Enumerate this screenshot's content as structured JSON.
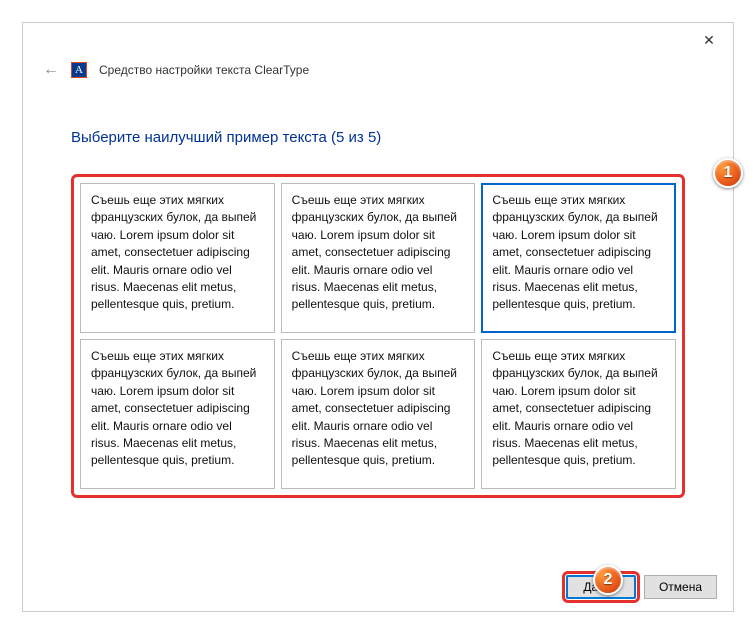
{
  "window": {
    "title": "Средство настройки текста ClearType",
    "app_icon_letter": "A",
    "close_label": "✕"
  },
  "heading": "Выберите наилучший пример текста (5 из 5)",
  "sample_text": "Съешь еще этих мягких французских булок, да выпей чаю. Lorem ipsum dolor sit amet, consectetuer adipiscing elit. Mauris ornare odio vel risus. Maecenas elit metus, pellentesque quis, pretium.",
  "samples": [
    {
      "selected": false
    },
    {
      "selected": false
    },
    {
      "selected": true
    },
    {
      "selected": false
    },
    {
      "selected": false
    },
    {
      "selected": false
    }
  ],
  "footer": {
    "next": "Далее",
    "cancel": "Отмена"
  },
  "annotations": {
    "badge1": "1",
    "badge2": "2"
  }
}
